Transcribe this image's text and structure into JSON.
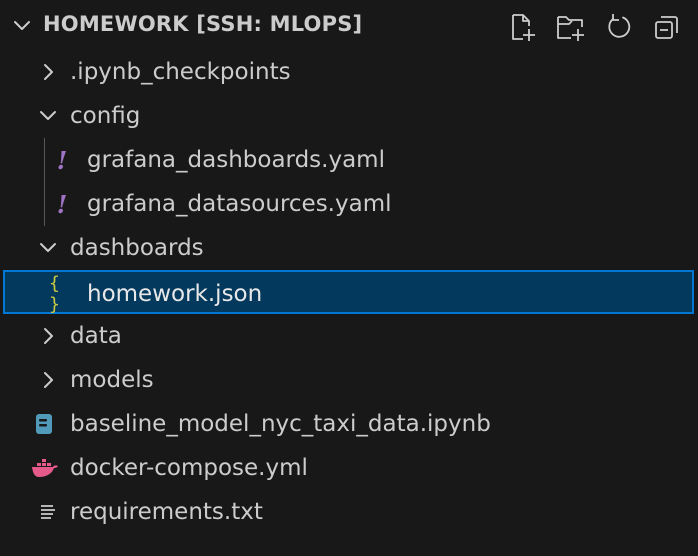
{
  "explorer": {
    "title": "HOMEWORK [SSH: MLOPS]",
    "toolbar": {
      "new_file_icon": "new-file-icon",
      "new_folder_icon": "new-folder-icon",
      "refresh_icon": "refresh-icon",
      "collapse_icon": "collapse-all-icon"
    }
  },
  "tree": {
    "items": [
      {
        "label": ".ipynb_checkpoints",
        "type": "folder",
        "expanded": false,
        "icon": "chevron-right-icon"
      },
      {
        "label": "config",
        "type": "folder",
        "expanded": true,
        "icon": "chevron-down-icon"
      },
      {
        "label": "grafana_dashboards.yaml",
        "type": "file",
        "icon": "yaml-icon",
        "glyph": "!"
      },
      {
        "label": "grafana_datasources.yaml",
        "type": "file",
        "icon": "yaml-icon",
        "glyph": "!"
      },
      {
        "label": "dashboards",
        "type": "folder",
        "expanded": true,
        "icon": "chevron-down-icon"
      },
      {
        "label": "homework.json",
        "type": "file",
        "icon": "json-icon",
        "glyph": "{ }",
        "selected": true
      },
      {
        "label": "data",
        "type": "folder",
        "expanded": false,
        "icon": "chevron-right-icon"
      },
      {
        "label": "models",
        "type": "folder",
        "expanded": false,
        "icon": "chevron-right-icon"
      },
      {
        "label": "baseline_model_nyc_taxi_data.ipynb",
        "type": "file",
        "icon": "notebook-icon"
      },
      {
        "label": "docker-compose.yml",
        "type": "file",
        "icon": "docker-icon"
      },
      {
        "label": "requirements.txt",
        "type": "file",
        "icon": "text-file-icon"
      }
    ]
  },
  "colors": {
    "background": "#181818",
    "text": "#cccccc",
    "selection_bg": "#04395e",
    "selection_border": "#0078d4",
    "yaml_icon": "#a074c4",
    "json_icon": "#cbcb41",
    "notebook_icon": "#519aba",
    "docker_icon": "#e45a8a"
  }
}
